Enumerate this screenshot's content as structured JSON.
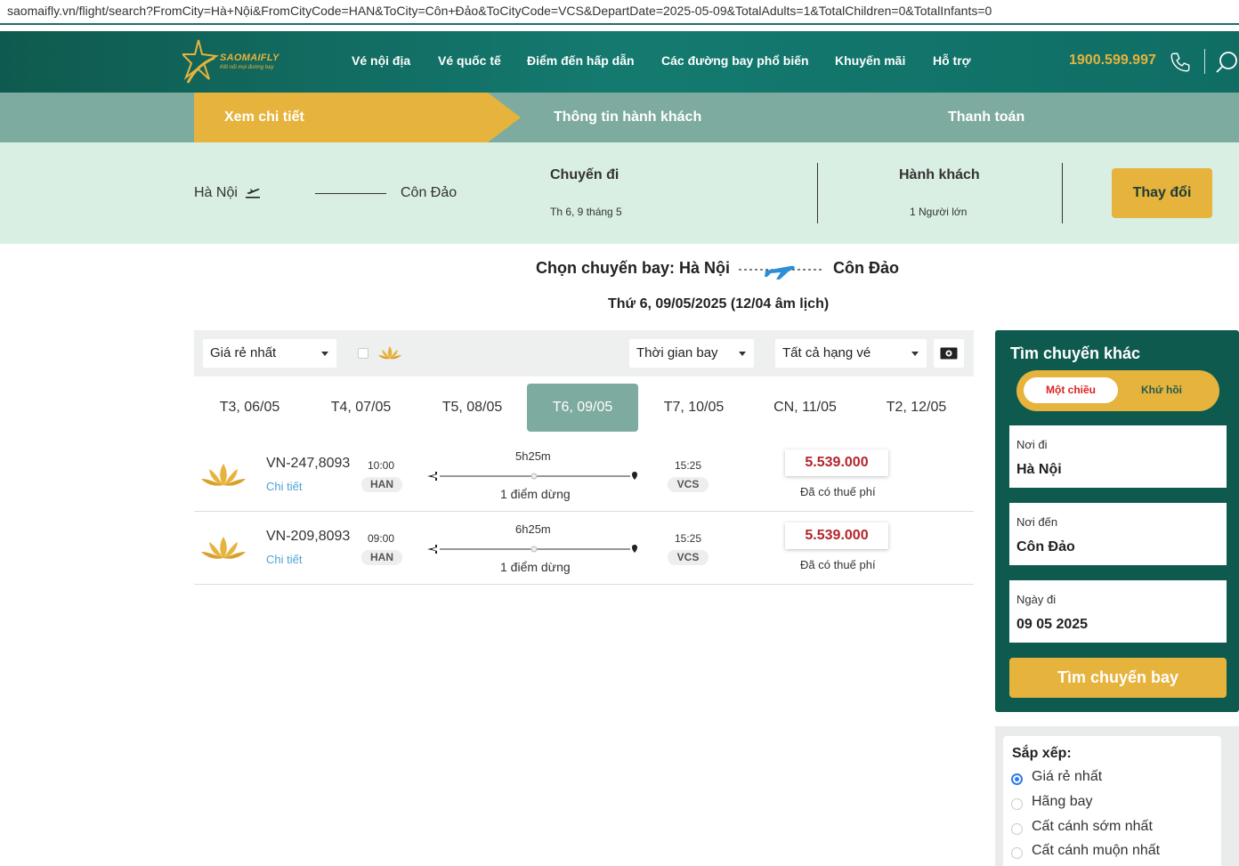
{
  "browser": {
    "url": "saomaifly.vn/flight/search?FromCity=Hà+Nội&FromCityCode=HAN&ToCity=Côn+Đảo&ToCityCode=VCS&DepartDate=2025-05-09&TotalAdults=1&TotalChildren=0&TotalInfants=0"
  },
  "header": {
    "brand": "SAOMAIFLY",
    "tagline": "Kết nối mọi đường bay",
    "nav": [
      "Vé nội địa",
      "Vé quốc tế",
      "Điểm đến hấp dẫn",
      "Các đường bay phổ biến",
      "Khuyến mãi",
      "Hỗ trợ"
    ],
    "hotline": "1900.599.997"
  },
  "steps": [
    "Xem chi tiết",
    "Thông tin hành khách",
    "Thanh toán"
  ],
  "summary": {
    "from": "Hà Nội",
    "to": "Côn Đảo",
    "trip_heading": "Chuyến đi",
    "trip_date": "Th 6, 9 tháng 5",
    "pax_heading": "Hành khách",
    "pax_value": "1 Người lớn",
    "change_button": "Thay đổi"
  },
  "title": {
    "route_from": "Chọn chuyến bay: Hà Nội",
    "route_to": "Côn Đảo",
    "date": "Thứ 6, 09/05/2025 (12/04 âm lịch)"
  },
  "filters": {
    "sort_select": "Giá rẻ nhất",
    "time_select": "Thời gian bay",
    "class_select": "Tất cả hạng vé"
  },
  "date_tabs": [
    "T3, 06/05",
    "T4, 07/05",
    "T5, 08/05",
    "T6, 09/05",
    "T7, 10/05",
    "CN, 11/05",
    "T2, 12/05"
  ],
  "active_date_tab": 3,
  "flights": [
    {
      "number": "VN-247,8093",
      "detail": "Chi tiết",
      "dep_time": "10:00",
      "dep_code": "HAN",
      "duration": "5h25m",
      "stops": "1 điểm dừng",
      "arr_time": "15:25",
      "arr_code": "VCS",
      "price": "5.539.000",
      "tax_note": "Đã có thuế phí"
    },
    {
      "number": "VN-209,8093",
      "detail": "Chi tiết",
      "dep_time": "09:00",
      "dep_code": "HAN",
      "duration": "6h25m",
      "stops": "1 điểm dừng",
      "arr_time": "15:25",
      "arr_code": "VCS",
      "price": "5.539.000",
      "tax_note": "Đã có thuế phí"
    }
  ],
  "search_panel": {
    "title": "Tìm chuyến khác",
    "one_way": "Một chiều",
    "round_trip": "Khứ hồi",
    "from_label": "Nơi đi",
    "from_value": "Hà Nội",
    "to_label": "Nơi đến",
    "to_value": "Côn Đảo",
    "date_label": "Ngày đi",
    "date_value": "09 05 2025",
    "search_button": "Tìm chuyến bay"
  },
  "sort": {
    "title": "Sắp xếp:",
    "options": [
      "Giá rẻ nhất",
      "Hãng bay",
      "Cất cánh sớm nhất",
      "Cất cánh muộn nhất"
    ],
    "selected": 0
  },
  "colors": {
    "brand_green": "#0f5a4f",
    "accent_gold": "#e6b33c",
    "step_teal": "#7dab9f",
    "price_red": "#b3242a"
  }
}
